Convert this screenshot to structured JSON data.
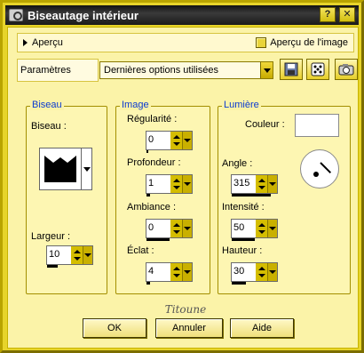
{
  "window": {
    "title": "Biseautage intérieur"
  },
  "titlebar": {
    "help_glyph": "?",
    "close_glyph": "✕"
  },
  "preview": {
    "toggle_label": "Aperçu",
    "image_label": "Aperçu de l'image",
    "image_checked": true
  },
  "parametres": {
    "label": "Paramètres",
    "preset_value": "Dernières options utilisées"
  },
  "biseau": {
    "title": "Biseau",
    "shape_label": "Biseau :",
    "largeur_label": "Largeur :",
    "largeur_value": "10"
  },
  "image": {
    "title": "Image",
    "regularite_label": "Régularité :",
    "regularite_value": "0",
    "profondeur_label": "Profondeur :",
    "profondeur_value": "1",
    "ambiance_label": "Ambiance :",
    "ambiance_value": "0",
    "eclat_label": "Éclat :",
    "eclat_value": "4"
  },
  "lumiere": {
    "title": "Lumière",
    "couleur_label": "Couleur :",
    "couleur_value": "#ffffff",
    "angle_label": "Angle :",
    "angle_value": "315",
    "intensite_label": "Intensité :",
    "intensite_value": "50",
    "hauteur_label": "Hauteur :",
    "hauteur_value": "30"
  },
  "signature": "Titoune",
  "buttons": {
    "ok": "OK",
    "annuler": "Annuler",
    "aide": "Aide"
  },
  "colors": {
    "accent": "#0b3bd0",
    "chrome": "#e7d42a",
    "panel": "#fbf3a8"
  }
}
